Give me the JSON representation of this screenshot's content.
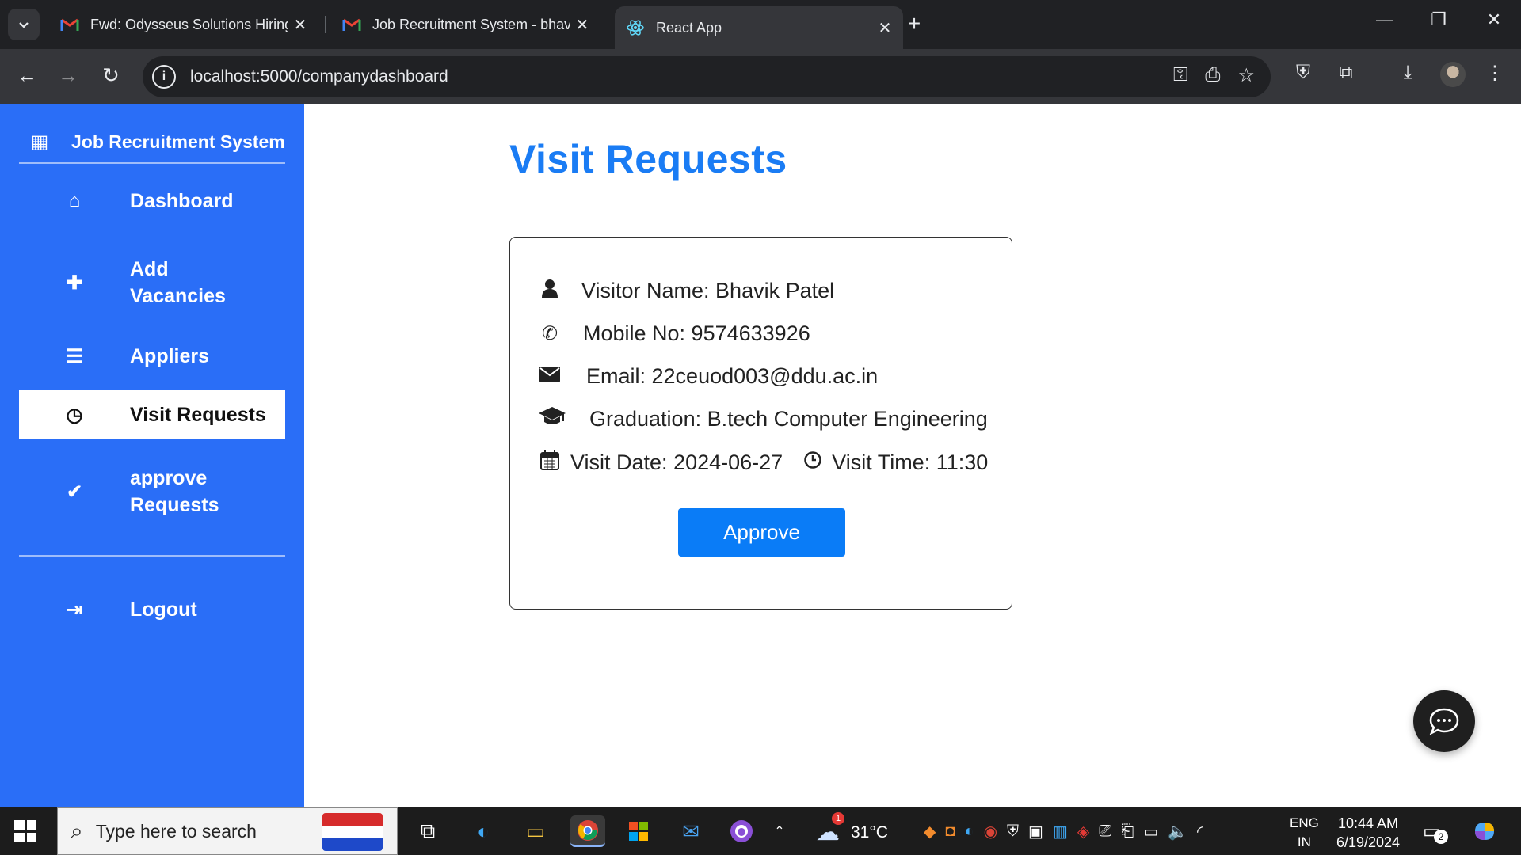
{
  "browser": {
    "tabs": [
      {
        "title": "Fwd: Odysseus Solutions Hiring",
        "icon": "gmail-icon"
      },
      {
        "title": "Job Recruitment System - bhavi",
        "icon": "gmail-icon"
      },
      {
        "title": "React App",
        "icon": "react-icon",
        "active": true
      }
    ],
    "url": "localhost:5000/companydashboard"
  },
  "sidebar": {
    "brand": "Job Recruitment System",
    "items": [
      {
        "label": "Dashboard",
        "icon": "home-icon"
      },
      {
        "label": "Add Vacancies",
        "icon": "plus-icon"
      },
      {
        "label": "Appliers",
        "icon": "list-icon"
      },
      {
        "label": "Visit Requests",
        "icon": "clock-icon",
        "active": true
      },
      {
        "label": "approve Requests",
        "icon": "check-icon"
      },
      {
        "label": "Logout",
        "icon": "logout-icon"
      }
    ],
    "colors": {
      "background": "#2a6ef7",
      "active_bg": "#ffffff"
    }
  },
  "main": {
    "title": "Visit Requests",
    "request": {
      "visitor_name": "Visitor Name: Bhavik Patel",
      "mobile": "Mobile No: 9574633926",
      "email": "Email: 22ceuod003@ddu.ac.in",
      "graduation": "Graduation: B.tech Computer Engineering",
      "visit_date": "Visit Date: 2024-06-27",
      "visit_time": "Visit Time: 11:30",
      "approve_label": "Approve"
    },
    "colors": {
      "title": "#1a7cf4",
      "button": "#0a7cf7"
    }
  },
  "taskbar": {
    "search_placeholder": "Type here to search",
    "weather": "31°C",
    "weather_badge": "1",
    "lang_1": "ENG",
    "lang_2": "IN",
    "time": "10:44 AM",
    "date": "6/19/2024",
    "notifications": "2"
  }
}
